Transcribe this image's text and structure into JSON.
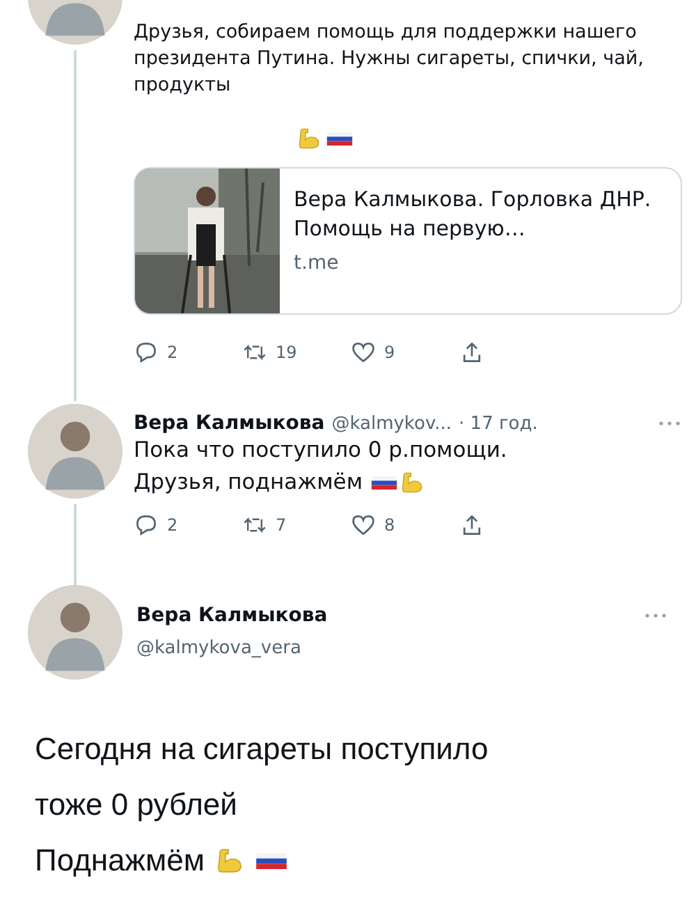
{
  "first_tweet": {
    "text": "Друзья, собираем помощь для поддержки нашего президента Путина. Нужны сигареты, спички, чай, продукты",
    "link_card": {
      "title": "Вера Калмыкова. Горловка ДНР. Помощь на первую…",
      "domain": "t.me"
    },
    "actions": {
      "replies": "2",
      "retweets": "19",
      "likes": "9"
    }
  },
  "second_tweet": {
    "author": "Вера Калмыкова",
    "handle": "@kalmykov...",
    "time": "· 17 год.",
    "lines": [
      "Пока что поступило 0 р.помощи.",
      "Друзья, поднажмём"
    ],
    "actions": {
      "replies": "2",
      "retweets": "7",
      "likes": "8"
    }
  },
  "third_tweet": {
    "author": "Вера Калмыкова",
    "handle": "@kalmykova_vera",
    "lines": [
      "Сегодня на сигареты поступило",
      "тоже 0 рублей",
      "Поднажмём"
    ]
  }
}
